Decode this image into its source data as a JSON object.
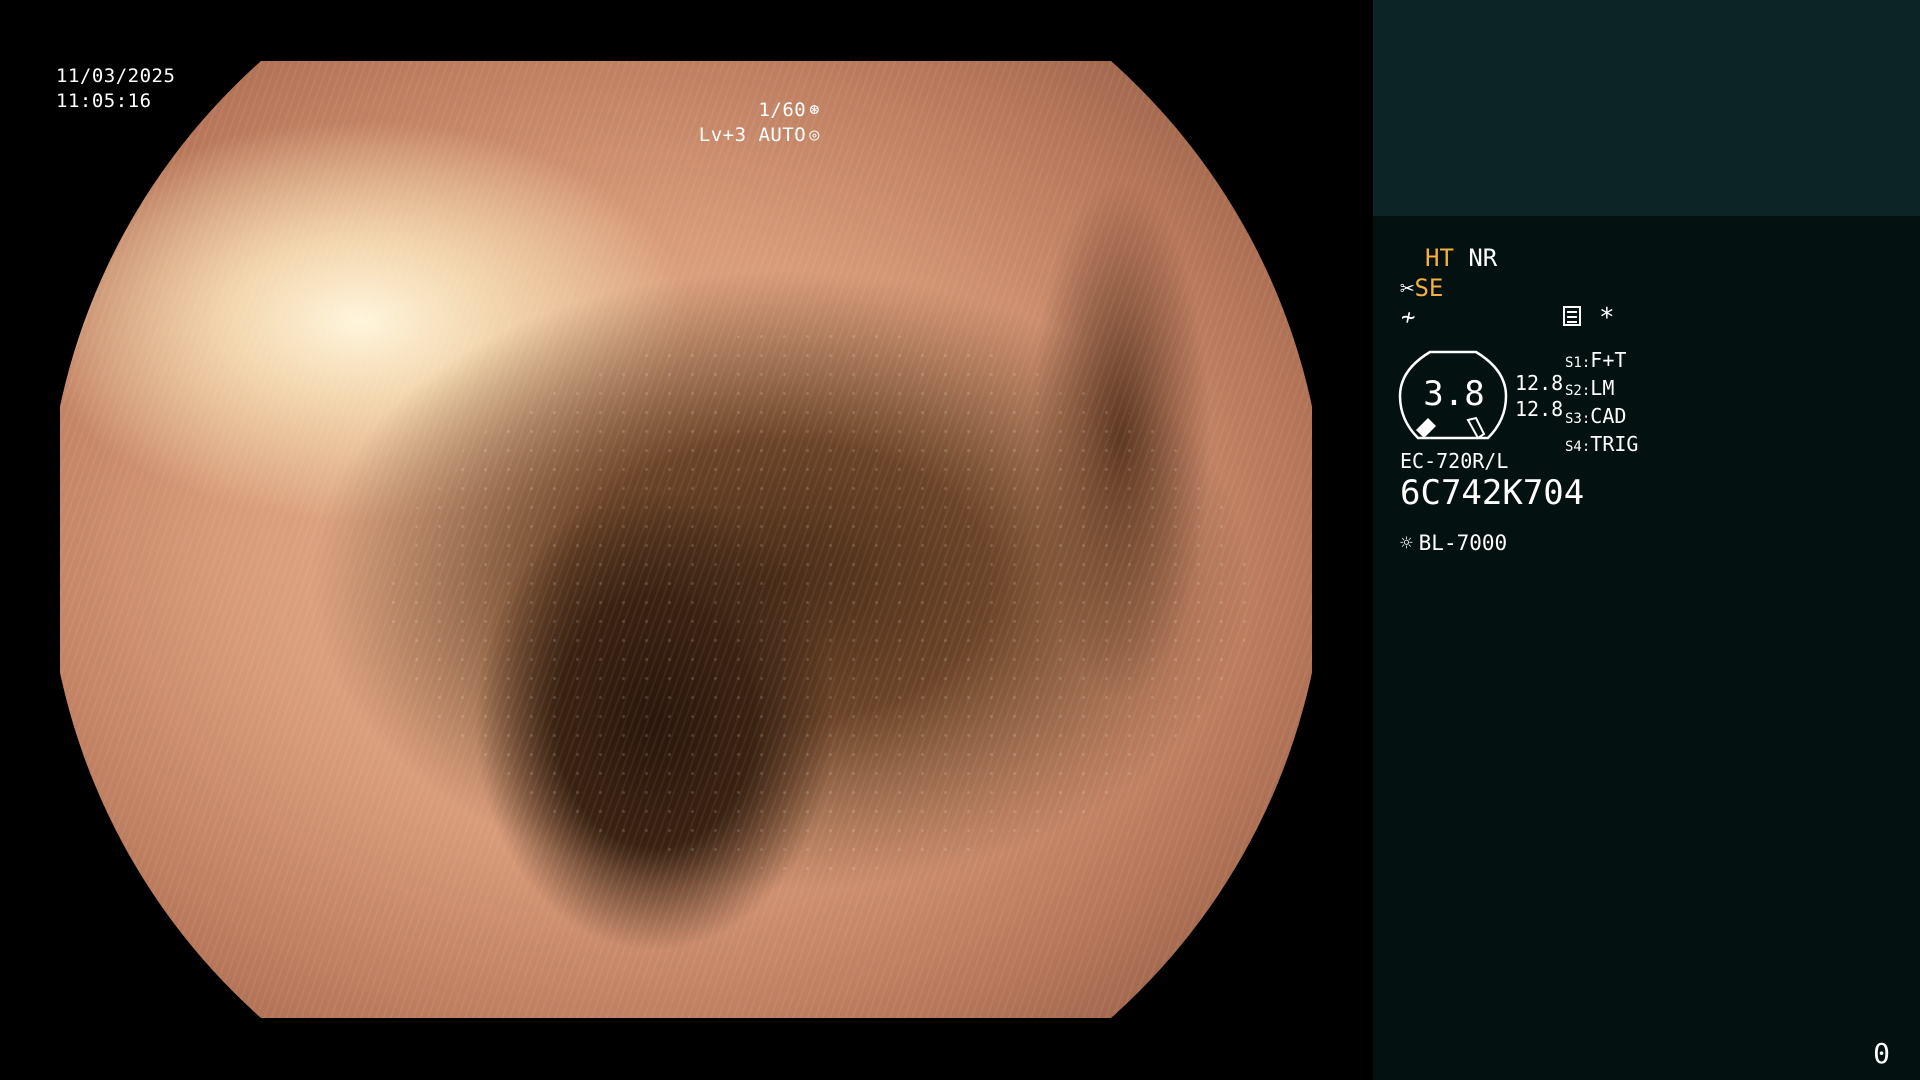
{
  "overlay": {
    "date": "11/03/2025",
    "time": "11:05:16",
    "shutter": "1/60",
    "iris": "Lv+3 AUTO"
  },
  "panel": {
    "ht": "HT",
    "nr": "NR",
    "se": "SE",
    "asterisk": "*",
    "gauge_value": "3.8",
    "gauge_num1": "12.8",
    "gauge_num2": "12.8",
    "switches": [
      {
        "key": "S1:",
        "value": "F+T"
      },
      {
        "key": "S2:",
        "value": "LM"
      },
      {
        "key": "S3:",
        "value": "CAD"
      },
      {
        "key": "S4:",
        "value": "TRIG"
      }
    ],
    "scope_model": "EC-720R/L",
    "scope_serial": "6C742K704",
    "light_source": "BL-7000",
    "counter": "0"
  },
  "colors": {
    "panel_bg": "#031210",
    "panel_top": "#0d2424",
    "accent_yellow": "#f5b041"
  },
  "icons": [
    "aperture-icon",
    "target-icon",
    "scissors-icon",
    "enhance-icon",
    "structure-icon",
    "gauge-icon",
    "sun-icon"
  ]
}
